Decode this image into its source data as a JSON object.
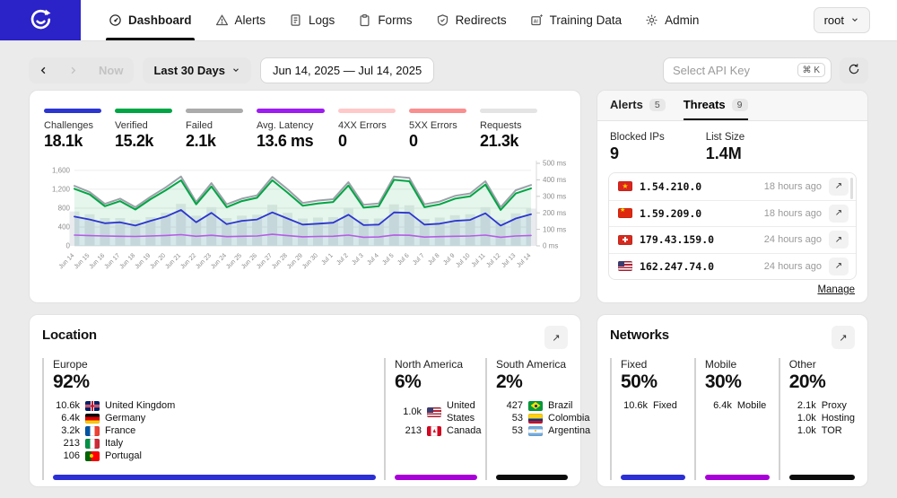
{
  "brand": {
    "logo_color": "#2b22c8"
  },
  "nav": {
    "items": [
      {
        "label": "Dashboard",
        "icon": "gauge-icon",
        "active": true
      },
      {
        "label": "Alerts",
        "icon": "warning-triangle-icon",
        "active": false
      },
      {
        "label": "Logs",
        "icon": "document-icon",
        "active": false
      },
      {
        "label": "Forms",
        "icon": "clipboard-icon",
        "active": false
      },
      {
        "label": "Redirects",
        "icon": "shield-check-icon",
        "active": false
      },
      {
        "label": "Training Data",
        "icon": "ai-box-icon",
        "active": false
      },
      {
        "label": "Admin",
        "icon": "gear-icon",
        "active": false
      }
    ],
    "user": "root"
  },
  "toolbar": {
    "now_label": "Now",
    "range_label": "Last 30 Days",
    "date_range": "Jun 14, 2025 — Jul 14, 2025",
    "api_key_placeholder": "Select API Key",
    "shortcut": "⌘ K"
  },
  "metrics": [
    {
      "label": "Challenges",
      "value": "18.1k",
      "color": "#2c35cf"
    },
    {
      "label": "Verified",
      "value": "15.2k",
      "color": "#00a544"
    },
    {
      "label": "Failed",
      "value": "2.1k",
      "color": "#ababab"
    },
    {
      "label": "Avg. Latency",
      "value": "13.6 ms",
      "color": "#9d1cf2"
    },
    {
      "label": "4XX Errors",
      "value": "0",
      "color": "#ffc9c9"
    },
    {
      "label": "5XX Errors",
      "value": "0",
      "color": "#f98f8f"
    },
    {
      "label": "Requests",
      "value": "21.3k",
      "color": "#e4e4e4"
    }
  ],
  "chart_data": {
    "type": "line",
    "x": [
      "Jun 14",
      "Jun 15",
      "Jun 16",
      "Jun 17",
      "Jun 18",
      "Jun 19",
      "Jun 20",
      "Jun 21",
      "Jun 22",
      "Jun 23",
      "Jun 24",
      "Jun 25",
      "Jun 26",
      "Jun 27",
      "Jun 28",
      "Jun 29",
      "Jun 30",
      "Jul 1",
      "Jul 2",
      "Jul 3",
      "Jul 4",
      "Jul 5",
      "Jul 6",
      "Jul 7",
      "Jul 8",
      "Jul 9",
      "Jul 10",
      "Jul 11",
      "Jul 12",
      "Jul 13",
      "Jul 14"
    ],
    "left_axis": {
      "ticks": [
        0,
        400,
        800,
        1200,
        1600
      ],
      "labels": [
        "0",
        "400",
        "800",
        "1,200",
        "1,600"
      ],
      "max": 1750
    },
    "right_axis": {
      "ticks": [
        0,
        100,
        200,
        300,
        400,
        500
      ],
      "unit": "ms",
      "max": 500
    },
    "bars": {
      "name": "Requests volume",
      "color": "#e9ebee",
      "values": [
        730,
        670,
        590,
        590,
        550,
        610,
        700,
        890,
        640,
        820,
        590,
        640,
        660,
        870,
        700,
        580,
        600,
        610,
        810,
        570,
        580,
        880,
        860,
        570,
        600,
        650,
        670,
        820,
        550,
        690,
        790
      ]
    },
    "series": [
      {
        "name": "Requests",
        "axis": "left",
        "color": "#9ba1a8",
        "width": 2,
        "values": [
          1270,
          1140,
          890,
          1000,
          820,
          1040,
          1240,
          1470,
          930,
          1330,
          880,
          1000,
          1070,
          1460,
          1200,
          910,
          960,
          990,
          1350,
          870,
          900,
          1470,
          1440,
          880,
          940,
          1060,
          1110,
          1370,
          820,
          1180,
          1290
        ]
      },
      {
        "name": "Verified",
        "axis": "left",
        "color": "#00a544",
        "width": 2,
        "fill": "rgba(0,165,68,0.10)",
        "values": [
          1210,
          1090,
          840,
          950,
          770,
          990,
          1180,
          1390,
          880,
          1260,
          820,
          950,
          1020,
          1390,
          1130,
          850,
          900,
          930,
          1280,
          810,
          840,
          1400,
          1370,
          820,
          880,
          1000,
          1050,
          1300,
          760,
          1110,
          1220
        ]
      },
      {
        "name": "Challenges",
        "axis": "left",
        "color": "#2c35cf",
        "width": 1.8,
        "fill": "rgba(44,53,207,0.07)",
        "values": [
          620,
          560,
          480,
          500,
          430,
          530,
          620,
          760,
          500,
          700,
          460,
          530,
          560,
          710,
          580,
          450,
          470,
          490,
          660,
          440,
          450,
          710,
          700,
          450,
          470,
          530,
          550,
          690,
          430,
          580,
          670
        ]
      },
      {
        "name": "Avg. Latency (ms)",
        "axis": "right",
        "color": "#b55ce6",
        "width": 1.6,
        "values": [
          65,
          62,
          60,
          58,
          57,
          60,
          63,
          68,
          58,
          64,
          56,
          58,
          60,
          70,
          62,
          55,
          57,
          58,
          65,
          52,
          54,
          66,
          64,
          53,
          56,
          58,
          60,
          65,
          52,
          60,
          63
        ]
      }
    ],
    "title": "",
    "xlabel": "",
    "ylabel": ""
  },
  "threat_panel": {
    "tabs": [
      {
        "label": "Alerts",
        "badge": "5",
        "active": false
      },
      {
        "label": "Threats",
        "badge": "9",
        "active": true
      }
    ],
    "stats": [
      {
        "label": "Blocked IPs",
        "value": "9"
      },
      {
        "label": "List Size",
        "value": "1.4M"
      }
    ],
    "rows": [
      {
        "flag": "vn",
        "ip": "1.54.210.0",
        "time": "18 hours ago"
      },
      {
        "flag": "cn",
        "ip": "1.59.209.0",
        "time": "18 hours ago"
      },
      {
        "flag": "ch",
        "ip": "179.43.159.0",
        "time": "24 hours ago"
      },
      {
        "flag": "us",
        "ip": "162.247.74.0",
        "time": "24 hours ago"
      }
    ],
    "open_icon": "↗",
    "manage_label": "Manage"
  },
  "location": {
    "title": "Location",
    "expand_icon": "↗",
    "regions": [
      {
        "name": "Europe",
        "pct": "92%",
        "bar_color": "#2b2fd4",
        "countries": [
          {
            "value": "10.6k",
            "flag": "gb",
            "name": "United Kingdom"
          },
          {
            "value": "6.4k",
            "flag": "de",
            "name": "Germany"
          },
          {
            "value": "3.2k",
            "flag": "fr",
            "name": "France"
          },
          {
            "value": "213",
            "flag": "it",
            "name": "Italy"
          },
          {
            "value": "106",
            "flag": "pt",
            "name": "Portugal"
          }
        ]
      },
      {
        "name": "North America",
        "pct": "6%",
        "bar_color": "#a800d8",
        "countries": [
          {
            "value": "1.0k",
            "flag": "us",
            "name": "United States"
          },
          {
            "value": "213",
            "flag": "ca",
            "name": "Canada"
          }
        ]
      },
      {
        "name": "South America",
        "pct": "2%",
        "bar_color": "#0c0c0c",
        "countries": [
          {
            "value": "427",
            "flag": "br",
            "name": "Brazil"
          },
          {
            "value": "53",
            "flag": "co",
            "name": "Colombia"
          },
          {
            "value": "53",
            "flag": "ar",
            "name": "Argentina"
          }
        ]
      }
    ]
  },
  "networks": {
    "title": "Networks",
    "expand_icon": "↗",
    "groups": [
      {
        "name": "Fixed",
        "pct": "50%",
        "bar_color": "#2b2fd4",
        "items": [
          {
            "value": "10.6k",
            "name": "Fixed"
          }
        ]
      },
      {
        "name": "Mobile",
        "pct": "30%",
        "bar_color": "#a800d8",
        "items": [
          {
            "value": "6.4k",
            "name": "Mobile"
          }
        ]
      },
      {
        "name": "Other",
        "pct": "20%",
        "bar_color": "#0c0c0c",
        "items": [
          {
            "value": "2.1k",
            "name": "Proxy"
          },
          {
            "value": "1.0k",
            "name": "Hosting"
          },
          {
            "value": "1.0k",
            "name": "TOR"
          }
        ]
      }
    ]
  }
}
